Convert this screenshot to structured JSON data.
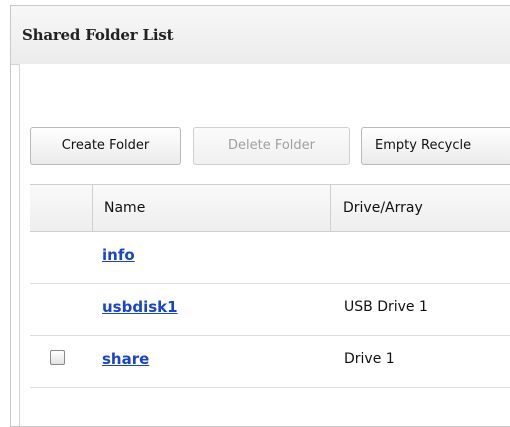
{
  "panel": {
    "title": "Shared Folder List"
  },
  "toolbar": {
    "create_label": "Create Folder",
    "delete_label": "Delete Folder",
    "empty_label": "Empty Recycle"
  },
  "table": {
    "columns": [
      "Name",
      "Drive/Array"
    ],
    "rows": [
      {
        "name": "info",
        "drive": "",
        "checkbox": false
      },
      {
        "name": "usbdisk1",
        "drive": "USB Drive 1",
        "checkbox": false
      },
      {
        "name": "share",
        "drive": "Drive 1",
        "checkbox": true,
        "checked": false
      }
    ]
  },
  "colors": {
    "link": "#1a45c8",
    "border": "#c8c8c8"
  }
}
